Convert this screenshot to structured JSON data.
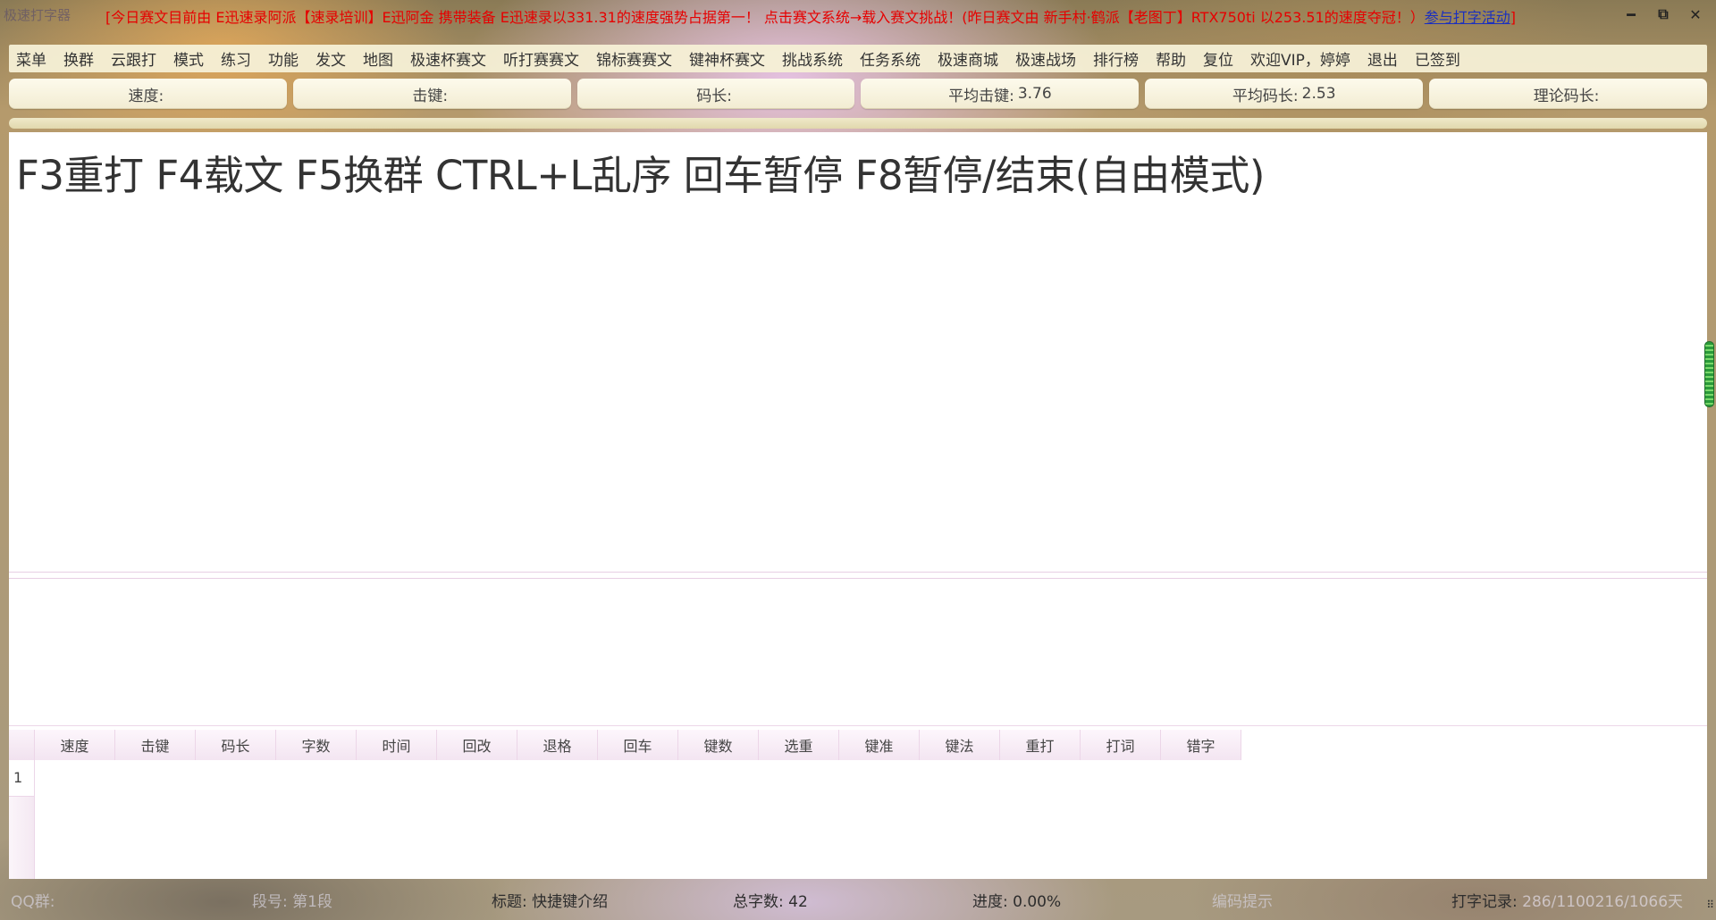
{
  "window": {
    "app_title": "极速打字器",
    "announcement": "[今日赛文目前由 E迅速录阿派【速录培训】E迅阿金 携带装备 E迅速录以331.31的速度强势占据第一！ 点击赛文系统→载入赛文挑战！(昨日赛文由 新手村·鹤派【老图丁】RTX750ti 以253.51的速度夺冠！）",
    "announcement_link": "参与打字活动",
    "announcement_end": "]",
    "minimize": "━",
    "restore": "⧉",
    "close": "✕"
  },
  "menu": [
    "菜单",
    "换群",
    "云跟打",
    "模式",
    "练习",
    "功能",
    "发文",
    "地图",
    "极速杯赛文",
    "听打赛赛文",
    "锦标赛赛文",
    "键神杯赛文",
    "挑战系统",
    "任务系统",
    "极速商城",
    "极速战场",
    "排行榜",
    "帮助",
    "复位",
    "欢迎VIP，婷婷",
    "退出",
    "已签到"
  ],
  "stats": [
    {
      "label": "速度:",
      "value": ""
    },
    {
      "label": "击键:",
      "value": ""
    },
    {
      "label": "码长:",
      "value": ""
    },
    {
      "label": "平均击键:",
      "value": "3.76"
    },
    {
      "label": "平均码长:",
      "value": "2.53"
    },
    {
      "label": "理论码长:",
      "value": ""
    }
  ],
  "progress_fraction": 0,
  "article_text": "F3重打 F4载文 F5换群 CTRL+L乱序 回车暂停 F8暂停/结束(自由模式)",
  "input_value": "",
  "results": {
    "columns": [
      "速度",
      "击键",
      "码长",
      "字数",
      "时间",
      "回改",
      "退格",
      "回车",
      "键数",
      "选重",
      "键准",
      "键法",
      "重打",
      "打词",
      "错字"
    ],
    "row_numbers": [
      "1"
    ]
  },
  "status": {
    "qq_group": {
      "label": "QQ群:",
      "value": ""
    },
    "segment": {
      "label": "段号:",
      "value": "第1段"
    },
    "title": {
      "label": "标题:",
      "value": "快捷键介绍"
    },
    "total_chars": {
      "label": "总字数:",
      "value": "42"
    },
    "progress": {
      "label": "进度:",
      "value": "0.00%"
    },
    "code_hint": {
      "label": "编码提示",
      "value": ""
    },
    "record": {
      "label": "打字记录:",
      "value": "286/1100216/1066天"
    },
    "grip": "⠿"
  }
}
